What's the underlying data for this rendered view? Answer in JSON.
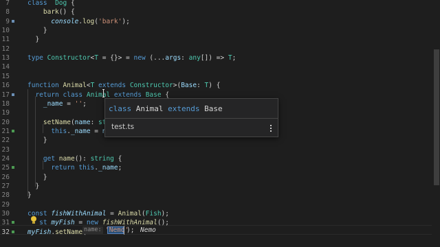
{
  "lines": [
    {
      "n": "7",
      "m": "",
      "code": "  class Dog {",
      "tok": [
        [
          "k",
          "class"
        ],
        [
          "",
          "  "
        ],
        [
          "t",
          "Dog"
        ],
        [
          "",
          " {"
        ]
      ]
    },
    {
      "n": "8",
      "m": "",
      "tok": [
        [
          "",
          "    "
        ],
        [
          "f",
          "bark"
        ],
        [
          "",
          "() {"
        ]
      ]
    },
    {
      "n": "9",
      "m": "mod",
      "tok": [
        [
          "",
          "      "
        ],
        [
          "v it",
          "console"
        ],
        [
          "",
          "."
        ],
        [
          "f",
          "log"
        ],
        [
          "",
          "("
        ],
        [
          "s",
          "'bark'"
        ],
        [
          "",
          ");"
        ]
      ]
    },
    {
      "n": "10",
      "m": "",
      "tok": [
        [
          "",
          "    }"
        ]
      ]
    },
    {
      "n": "11",
      "m": "",
      "tok": [
        [
          "",
          "  }"
        ]
      ]
    },
    {
      "n": "12",
      "m": "",
      "tok": []
    },
    {
      "n": "13",
      "m": "",
      "tok": [
        [
          "k",
          "type"
        ],
        [
          "",
          " "
        ],
        [
          "t",
          "Constructor"
        ],
        [
          "",
          "<"
        ],
        [
          "t",
          "T"
        ],
        [
          "",
          " = {}> = "
        ],
        [
          "k",
          "new"
        ],
        [
          "",
          " (..."
        ],
        [
          "v",
          "args"
        ],
        [
          "",
          ": "
        ],
        [
          "t",
          "any"
        ],
        [
          "",
          "[]) => "
        ],
        [
          "t",
          "T"
        ],
        [
          "",
          ";"
        ]
      ]
    },
    {
      "n": "14",
      "m": "",
      "tok": []
    },
    {
      "n": "15",
      "m": "",
      "tok": []
    },
    {
      "n": "16",
      "m": "",
      "tok": [
        [
          "k",
          "function"
        ],
        [
          "",
          " "
        ],
        [
          "f",
          "Animal"
        ],
        [
          "",
          "<"
        ],
        [
          "t",
          "T"
        ],
        [
          "",
          " "
        ],
        [
          "k",
          "extends"
        ],
        [
          "",
          " "
        ],
        [
          "t",
          "Constructor"
        ],
        [
          "",
          ">("
        ],
        [
          "v",
          "Base"
        ],
        [
          "",
          ": "
        ],
        [
          "t",
          "T"
        ],
        [
          "",
          ") {"
        ]
      ]
    },
    {
      "n": "17",
      "m": "mod",
      "tok": [
        [
          "",
          "  "
        ],
        [
          "k",
          "return"
        ],
        [
          "",
          " "
        ],
        [
          "k",
          "class"
        ],
        [
          "",
          " "
        ],
        [
          "t",
          "Animal"
        ],
        [
          "",
          " "
        ],
        [
          "k",
          "extends"
        ],
        [
          "",
          " "
        ],
        [
          "t",
          "Base"
        ],
        [
          "",
          " {"
        ]
      ]
    },
    {
      "n": "18",
      "m": "",
      "tok": [
        [
          "",
          "    "
        ],
        [
          "v",
          "_name"
        ],
        [
          "",
          " = "
        ],
        [
          "s",
          "''"
        ],
        [
          "",
          ";"
        ]
      ]
    },
    {
      "n": "19",
      "m": "",
      "tok": []
    },
    {
      "n": "20",
      "m": "",
      "tok": [
        [
          "",
          "    "
        ],
        [
          "f",
          "setName"
        ],
        [
          "",
          "("
        ],
        [
          "v",
          "name"
        ],
        [
          "",
          ": "
        ],
        [
          "t",
          "str"
        ]
      ]
    },
    {
      "n": "21",
      "m": "add",
      "tok": [
        [
          "",
          "      "
        ],
        [
          "k",
          "this"
        ],
        [
          "",
          "."
        ],
        [
          "v",
          "_name"
        ],
        [
          "",
          " = "
        ],
        [
          "v",
          "na"
        ]
      ]
    },
    {
      "n": "22",
      "m": "",
      "tok": [
        [
          "",
          "    }"
        ]
      ]
    },
    {
      "n": "23",
      "m": "",
      "tok": []
    },
    {
      "n": "24",
      "m": "",
      "tok": [
        [
          "",
          "    "
        ],
        [
          "k",
          "get"
        ],
        [
          "",
          " "
        ],
        [
          "f",
          "name"
        ],
        [
          "",
          "(): "
        ],
        [
          "t",
          "string"
        ],
        [
          "",
          " {"
        ]
      ]
    },
    {
      "n": "25",
      "m": "add",
      "tok": [
        [
          "",
          "      "
        ],
        [
          "k",
          "return"
        ],
        [
          "",
          " "
        ],
        [
          "k",
          "this"
        ],
        [
          "",
          "."
        ],
        [
          "v",
          "_name"
        ],
        [
          "",
          ";"
        ]
      ]
    },
    {
      "n": "26",
      "m": "",
      "tok": [
        [
          "",
          "    }"
        ]
      ]
    },
    {
      "n": "27",
      "m": "",
      "tok": [
        [
          "",
          "  }"
        ]
      ]
    },
    {
      "n": "28",
      "m": "",
      "tok": [
        [
          "",
          "}"
        ]
      ]
    },
    {
      "n": "29",
      "m": "",
      "tok": []
    },
    {
      "n": "30",
      "m": "",
      "tok": [
        [
          "k",
          "const"
        ],
        [
          "",
          " "
        ],
        [
          "v it",
          "fishWithAnimal"
        ],
        [
          "",
          " = "
        ],
        [
          "f",
          "Animal"
        ],
        [
          "",
          "("
        ],
        [
          "t",
          "Fish"
        ],
        [
          "",
          ");"
        ]
      ]
    },
    {
      "n": "31",
      "m": "add",
      "tok": [
        [
          "",
          "   "
        ],
        [
          "k",
          "st"
        ],
        [
          "",
          " "
        ],
        [
          "v it",
          "myFish"
        ],
        [
          "",
          " = "
        ],
        [
          "k",
          "new"
        ],
        [
          "",
          " "
        ],
        [
          "f it",
          "fishWithAnimal"
        ],
        [
          "",
          "();"
        ]
      ]
    },
    {
      "n": "32",
      "m": "add",
      "cur": true,
      "tok": [
        [
          "v it",
          "myFish"
        ],
        [
          "",
          "."
        ],
        [
          "f",
          "setName"
        ],
        [
          "",
          "("
        ]
      ]
    }
  ],
  "popup": {
    "sig": [
      [
        "k",
        "class"
      ],
      [
        "",
        " Animal "
      ],
      [
        "k",
        "extends"
      ],
      [
        "",
        " Base"
      ]
    ],
    "file": "test.ts",
    "more_icon": "more-vertical-icon"
  },
  "inline": {
    "param_hint": "name:",
    "selected_value": "'Nemo'",
    "tail": ");",
    "ghost_text": "Nemo"
  },
  "icons": {
    "lightbulb": "lightbulb-icon"
  },
  "colors": {
    "background": "#1e1e1e",
    "keyword": "#569cd6",
    "type": "#4ec9b0",
    "function": "#dcdcaa",
    "variable": "#9cdcfe",
    "string": "#ce9178",
    "added": "#4c9a52",
    "modified": "#6b8fb5"
  }
}
